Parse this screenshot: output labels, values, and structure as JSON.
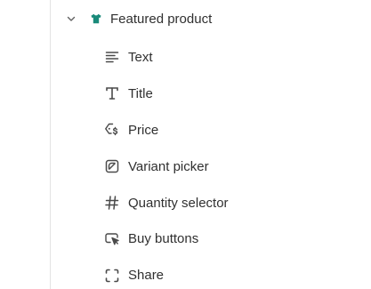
{
  "section": {
    "label": "Featured product",
    "expanded": true,
    "chevron_icon": "chevron-down-icon",
    "icon": "tshirt-icon",
    "icon_color": "#1a8a7a"
  },
  "blocks": [
    {
      "label": "Text",
      "icon": "text-lines-icon"
    },
    {
      "label": "Title",
      "icon": "title-t-icon"
    },
    {
      "label": "Price",
      "icon": "price-tag-icon"
    },
    {
      "label": "Variant picker",
      "icon": "variant-picker-icon"
    },
    {
      "label": "Quantity selector",
      "icon": "hash-icon"
    },
    {
      "label": "Buy buttons",
      "icon": "cursor-click-icon"
    },
    {
      "label": "Share",
      "icon": "share-brackets-icon"
    }
  ],
  "colors": {
    "text": "#303030",
    "icon": "#4a4a4a",
    "divider": "#e3e3e3"
  }
}
